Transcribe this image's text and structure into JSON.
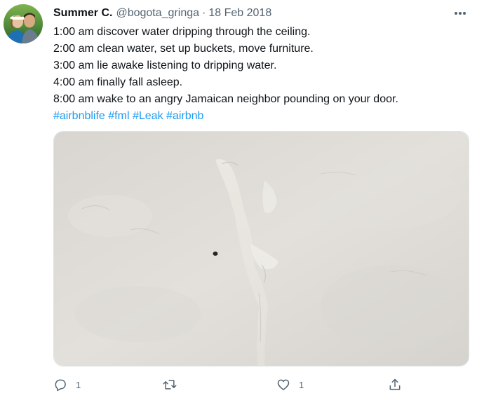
{
  "tweet": {
    "author": {
      "display_name": "Summer C.",
      "handle": "@bogota_gringa",
      "avatar_icon": "profile-photo-avatar"
    },
    "separator": "·",
    "date": "18 Feb 2018",
    "more_icon": "more-horizontal-icon",
    "text_lines": [
      "1:00 am discover water dripping through the ceiling.",
      "2:00 am clean water, set up buckets, move furniture.",
      "3:00 am lie awake listening to dripping water.",
      "4:00 am finally fall asleep.",
      "8:00 am wake to an angry Jamaican neighbor pounding on your door."
    ],
    "hashtags": [
      "#airbnblife",
      "#fml",
      "#Leak",
      "#airbnb"
    ],
    "actions": {
      "reply": {
        "icon": "reply-icon",
        "count": "1"
      },
      "retweet": {
        "icon": "retweet-icon"
      },
      "like": {
        "icon": "heart-icon",
        "count": "1"
      },
      "share": {
        "icon": "share-icon"
      }
    },
    "colors": {
      "link": "#1d9bf0",
      "secondary_text": "#536471",
      "primary_text": "#0f1419"
    }
  }
}
